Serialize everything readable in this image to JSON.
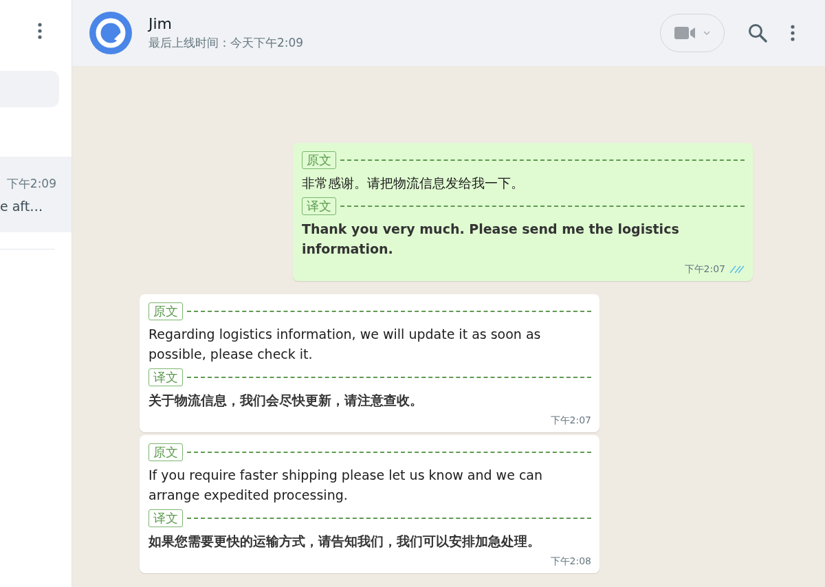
{
  "sidebar": {
    "chat_item": {
      "time": "下午2:09",
      "preview": "e aft…",
      "selected": true
    }
  },
  "header": {
    "name": "Jim",
    "status": "最后上线时间：今天下午2:09"
  },
  "messages": [
    {
      "kind": "outgoing",
      "original_label": "原文",
      "original": "非常感谢。请把物流信息发给我一下。",
      "translation_label": "译文",
      "translation": "Thank you very much. Please send me the logistics information.",
      "time": "下午2:07",
      "read": true
    },
    {
      "kind": "incoming",
      "original_label": "原文",
      "original": "Regarding logistics information, we will update it as soon as possible, please check it.",
      "translation_label": "译文",
      "translation": "关于物流信息，我们会尽快更新，请注意查收。",
      "time": "下午2:07"
    },
    {
      "kind": "incoming",
      "original_label": "原文",
      "original": "If you require faster shipping please let us know and we can arrange expedited processing.",
      "translation_label": "译文",
      "translation": "如果您需要更快的运输方式，请告知我们，我们可以安排加急处理。",
      "time": "下午2:08"
    }
  ]
}
